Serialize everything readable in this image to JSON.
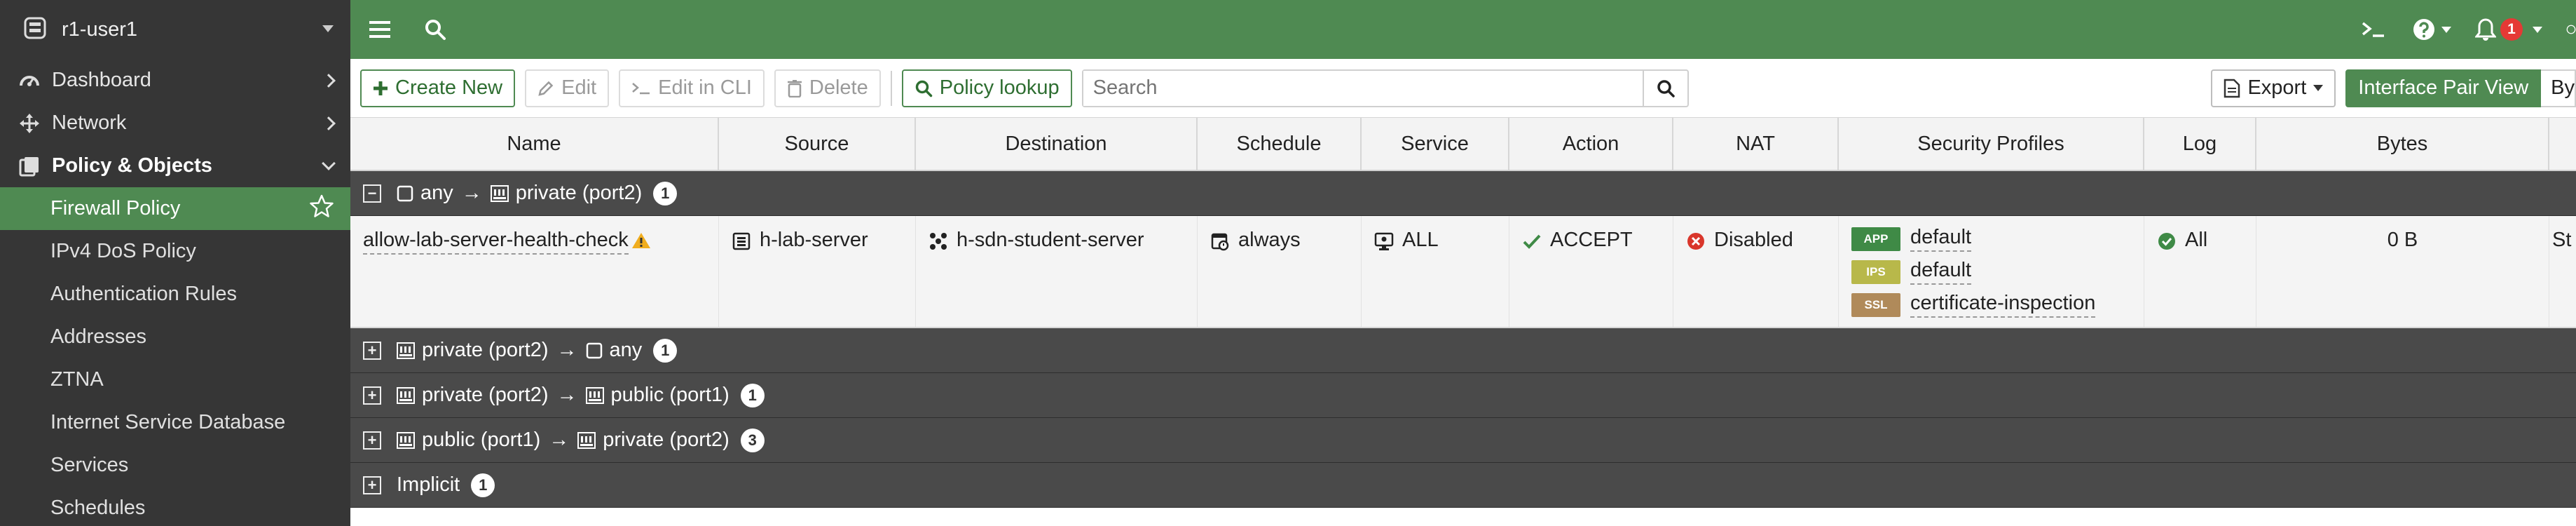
{
  "sidebar": {
    "device_name": "r1-user1",
    "items": [
      {
        "label": "Dashboard"
      },
      {
        "label": "Network"
      },
      {
        "label": "Policy & Objects"
      }
    ],
    "subitems": [
      {
        "label": "Firewall Policy"
      },
      {
        "label": "IPv4 DoS Policy"
      },
      {
        "label": "Authentication Rules"
      },
      {
        "label": "Addresses"
      },
      {
        "label": "ZTNA"
      },
      {
        "label": "Internet Service Database"
      },
      {
        "label": "Services"
      },
      {
        "label": "Schedules"
      }
    ]
  },
  "topbar": {
    "notification_count": "1"
  },
  "toolbar": {
    "create_new": "Create New",
    "edit": "Edit",
    "edit_cli": "Edit in CLI",
    "delete": "Delete",
    "policy_lookup": "Policy lookup",
    "search_placeholder": "Search",
    "export": "Export",
    "interface_pair_view": "Interface Pair View",
    "by_sequence": "By"
  },
  "table": {
    "columns": [
      "Name",
      "Source",
      "Destination",
      "Schedule",
      "Service",
      "Action",
      "NAT",
      "Security Profiles",
      "Log",
      "Bytes",
      "St"
    ],
    "groups": [
      {
        "from": "any",
        "to": "private (port2)",
        "count": "1",
        "expanded": true
      },
      {
        "from": "private (port2)",
        "to": "any",
        "count": "1",
        "expanded": false
      },
      {
        "from": "private (port2)",
        "to": "public (port1)",
        "count": "1",
        "expanded": false
      },
      {
        "from": "public (port1)",
        "to": "private (port2)",
        "count": "3",
        "expanded": false
      }
    ],
    "implicit": {
      "label": "Implicit",
      "count": "1"
    },
    "policy": {
      "name": "allow-lab-server-health-check",
      "source": "h-lab-server",
      "destination": "h-sdn-student-server",
      "schedule": "always",
      "service": "ALL",
      "action": "ACCEPT",
      "nat": "Disabled",
      "profiles": [
        {
          "tag": "APP",
          "name": "default",
          "color": "#3f8a46"
        },
        {
          "tag": "IPS",
          "name": "default",
          "color": "#b8b84a"
        },
        {
          "tag": "SSL",
          "name": "certificate-inspection",
          "color": "#b08a5a"
        }
      ],
      "log": "All",
      "bytes": "0 B",
      "status": "St"
    }
  },
  "colors": {
    "brand_green": "#4f8a52",
    "sidebar_bg": "#363636",
    "group_row_bg": "#4a4a4a",
    "notification_red": "#e53935"
  }
}
